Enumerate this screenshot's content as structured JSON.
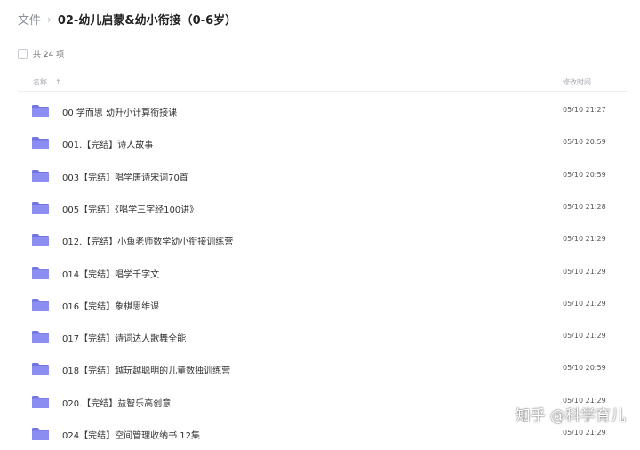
{
  "breadcrumb": {
    "root": "文件",
    "separator": "›",
    "current": "02-幼儿启蒙&幼小衔接（0-6岁）"
  },
  "toolbar": {
    "count_label": "共 24 项"
  },
  "table_header": {
    "name": "名称",
    "sort_icon": "↑",
    "modified": "修改时间"
  },
  "rows": [
    {
      "name": "00 学而思 幼升小计算衔接课",
      "time": "05/10 21:27",
      "icon": "folder-icon"
    },
    {
      "name": "001.【完结】诗人故事",
      "time": "05/10 20:59",
      "icon": "folder-icon"
    },
    {
      "name": "003【完结】唱学唐诗宋词70首",
      "time": "05/10 20:59",
      "icon": "folder-icon"
    },
    {
      "name": "005【完结】《唱学三字经100讲》",
      "time": "05/10 21:28",
      "icon": "folder-icon"
    },
    {
      "name": "012.【完结】小鱼老师数学幼小衔接训练营",
      "time": "05/10 21:29",
      "icon": "folder-icon"
    },
    {
      "name": "014【完结】唱学千字文",
      "time": "05/10 21:29",
      "icon": "folder-icon"
    },
    {
      "name": "016【完结】象棋思维课",
      "time": "05/10 21:29",
      "icon": "folder-icon"
    },
    {
      "name": "017【完结】诗词达人歌舞全能",
      "time": "05/10 21:29",
      "icon": "folder-icon"
    },
    {
      "name": "018【完结】越玩越聪明的儿童数独训练营",
      "time": "05/10 20:59",
      "icon": "folder-icon"
    },
    {
      "name": "020.【完结】益智乐高创意",
      "time": "05/10 21:29",
      "icon": "folder-icon"
    },
    {
      "name": "024【完结】空间管理收纳书 12集",
      "time": "05/10 21:29",
      "icon": "folder-icon"
    }
  ],
  "watermark": "知乎 @科学育儿",
  "colors": {
    "folder_front": "#8b8ef0",
    "folder_back": "#7174e3",
    "text": "#333333",
    "muted": "#a6a9af"
  }
}
